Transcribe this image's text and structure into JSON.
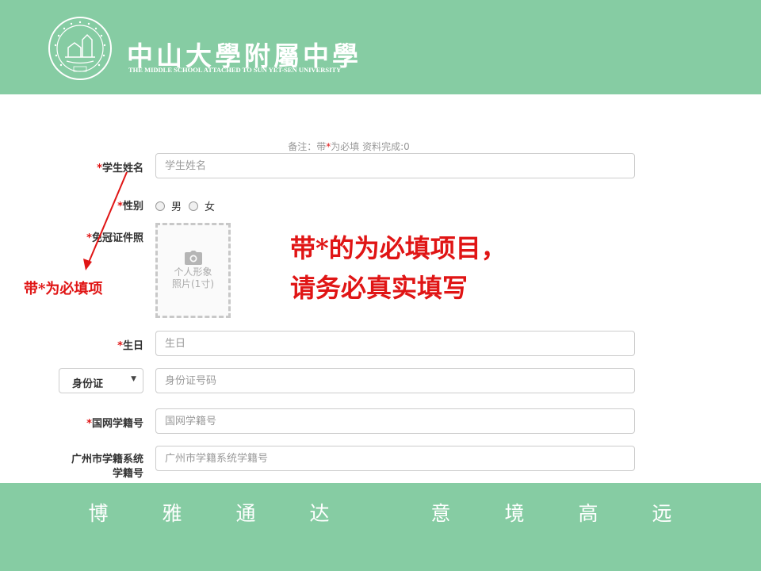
{
  "header": {
    "school_name_cn": "中山大學附屬中學",
    "school_name_en": "THE MIDDLE SCHOOL ATTACHED TO SUN YET-SEN UNIVERSITY",
    "logo_icon": "school-seal-icon",
    "background_color": "#86cca3"
  },
  "form": {
    "note_prefix": "备注：带",
    "note_star": "*",
    "note_suffix": "为必填 资料完成:0",
    "name": {
      "star": "*",
      "label": "学生姓名",
      "placeholder": "学生姓名"
    },
    "gender": {
      "star": "*",
      "label": "性别",
      "options": [
        "男",
        "女"
      ]
    },
    "photo": {
      "star": "*",
      "label": "免冠证件照",
      "line1": "个人形象",
      "line2": "照片(1寸)",
      "icon": "camera-icon"
    },
    "birthday": {
      "star": "*",
      "label": "生日",
      "placeholder": "生日"
    },
    "id": {
      "select_value": "身份证",
      "placeholder": "身份证号码"
    },
    "national_id": {
      "star": "*",
      "label": "国网学籍号",
      "placeholder": "国网学籍号"
    },
    "gz_id": {
      "label_line1": "广州市学籍系统",
      "label_line2": "学籍号",
      "placeholder": "广州市学籍系统学籍号"
    }
  },
  "annotations": {
    "small": "带*为必填项",
    "big_line1": "带*的为必填项目，",
    "big_line2": "请务必真实填写",
    "color": "#e01515"
  },
  "footer": {
    "motto": [
      "博",
      "雅",
      "通",
      "达",
      "意",
      "境",
      "高",
      "远"
    ],
    "background_color": "#86cca3"
  }
}
